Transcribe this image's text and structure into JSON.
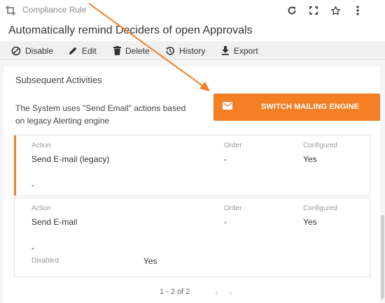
{
  "header": {
    "breadcrumb": "Compliance Rule",
    "title": "Automatically remind Deciders of open Approvals"
  },
  "toolbar": {
    "disable_label": "Disable",
    "edit_label": "Edit",
    "delete_label": "Delete",
    "history_label": "History",
    "export_label": "Export"
  },
  "section": {
    "title": "Subsequent Activities",
    "description": "The System uses \"Send Email\" actions based on legacy Alerting engine",
    "switch_button_label": "SWITCH MAILING ENGINE"
  },
  "activities": [
    {
      "action_label": "Action",
      "action": "Send E-mail (legacy)",
      "order_label": "Order",
      "order": "-",
      "configured_label": "Configured",
      "configured": "Yes",
      "extra": "-"
    },
    {
      "action_label": "Action",
      "action": "Send E-mail",
      "order_label": "Order",
      "order": "-",
      "configured_label": "Configured",
      "configured": "Yes",
      "extra": "-",
      "disabled_label": "Disabled",
      "disabled_value": "Yes"
    }
  ],
  "pagination": {
    "text": "1 - 2 of 2"
  },
  "colors": {
    "accent": "#f57f24",
    "toolbar_bg": "#f0f0f0",
    "page_bg": "#f5f5f5"
  },
  "icons": [
    "crop-icon",
    "refresh-icon",
    "fullscreen-icon",
    "star-icon",
    "more-vert-icon",
    "disable-icon",
    "edit-icon",
    "delete-icon",
    "history-icon",
    "export-icon",
    "mail-icon",
    "chevron-left-icon",
    "chevron-right-icon"
  ]
}
